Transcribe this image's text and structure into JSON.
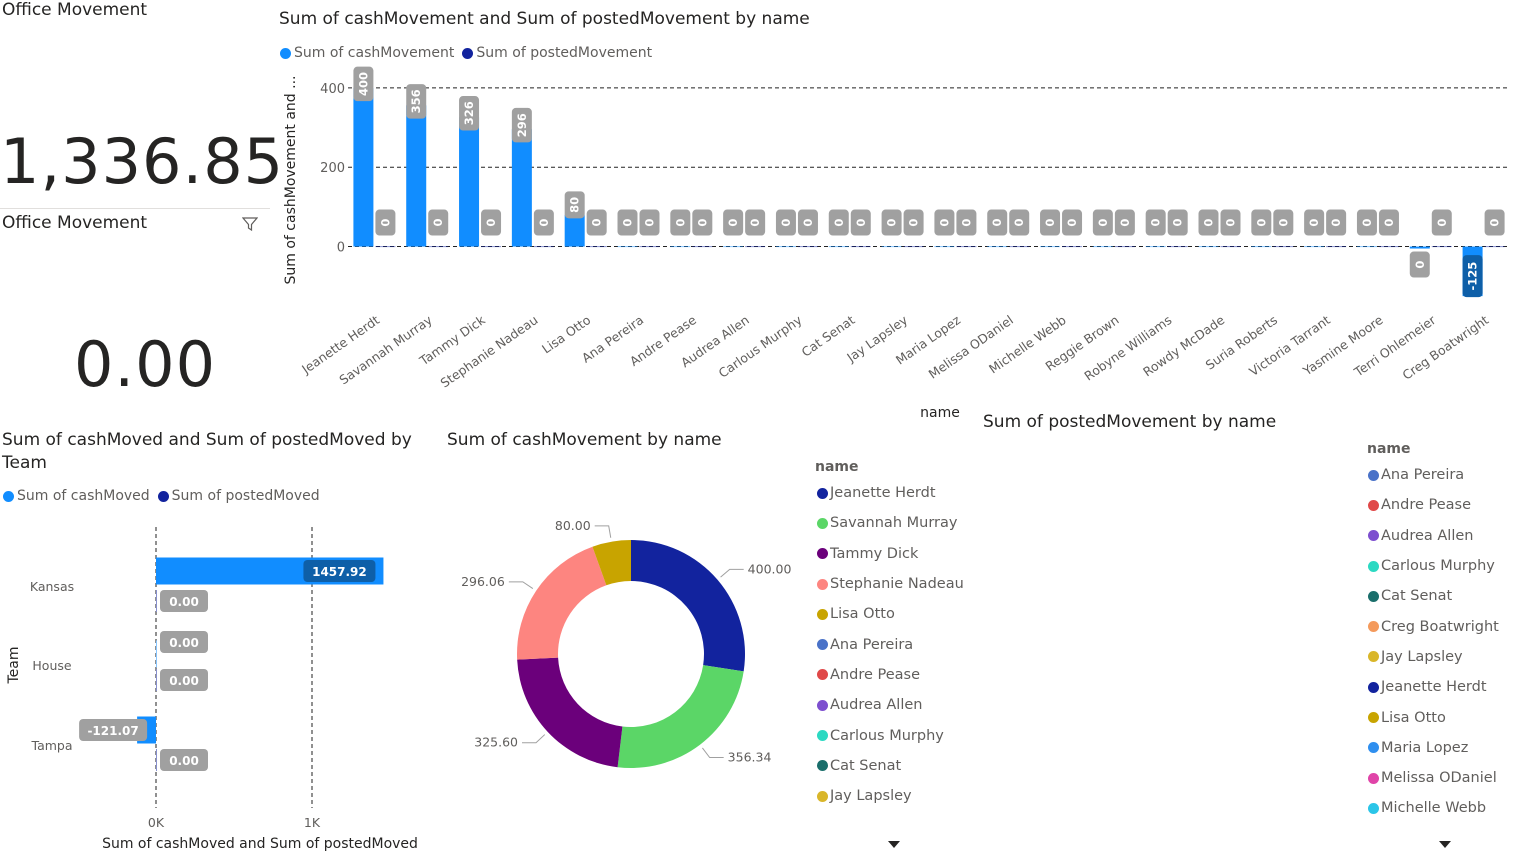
{
  "kpi1": {
    "title": "Office Movement",
    "value": "1,336.85"
  },
  "kpi2": {
    "title": "Office Movement",
    "value": "0.00"
  },
  "colors": {
    "cash": "#118dff",
    "posted": "#12239e",
    "label_bg": "#a0a0a0",
    "label_dark": "#0e5fa8"
  },
  "chart_data": [
    {
      "type": "bar",
      "title": "Sum of cashMovement and Sum of postedMovement by name",
      "xlabel": "name",
      "ylabel": "Sum of cashMovement and ...",
      "ylim": [
        -160,
        420
      ],
      "yticks": [
        0,
        200,
        400
      ],
      "legend": "top-left",
      "grid": true,
      "categories": [
        "Jeanette Herdt",
        "Savannah Murray",
        "Tammy Dick",
        "Stephanie Nadeau",
        "Lisa Otto",
        "Ana Pereira",
        "Andre Pease",
        "Audrea Allen",
        "Carlous Murphy",
        "Cat Senat",
        "Jay Lapsley",
        "Maria Lopez",
        "Melissa ODaniel",
        "Michelle Webb",
        "Reggie Brown",
        "Robyne Williams",
        "Rowdy McDade",
        "Suria Roberts",
        "Victoria Tarrant",
        "Yasmine Moore",
        "Terri Ohlemeier",
        "Creg Boatwright"
      ],
      "series": [
        {
          "name": "Sum of cashMovement",
          "values": [
            400,
            356,
            326,
            296,
            80,
            0,
            0,
            0,
            0,
            0,
            0,
            0,
            0,
            0,
            0,
            0,
            0,
            0,
            0,
            0,
            -5,
            -125
          ],
          "labels": [
            "400",
            "356",
            "326",
            "296",
            "80",
            "0",
            "0",
            "0",
            "0",
            "0",
            "0",
            "0",
            "0",
            "0",
            "0",
            "0",
            "0",
            "0",
            "0",
            "0",
            "0",
            "-125"
          ]
        },
        {
          "name": "Sum of postedMovement",
          "values": [
            0,
            0,
            0,
            0,
            0,
            0,
            0,
            0,
            0,
            0,
            0,
            0,
            0,
            0,
            0,
            0,
            0,
            0,
            0,
            0,
            0,
            0
          ],
          "labels": [
            "0",
            "0",
            "0",
            "0",
            "0",
            "0",
            "0",
            "0",
            "0",
            "0",
            "0",
            "0",
            "0",
            "0",
            "0",
            "0",
            "0",
            "0",
            "0",
            "0",
            "0",
            "0"
          ]
        }
      ]
    },
    {
      "type": "bar",
      "orientation": "horizontal",
      "title": "Sum of cashMoved and Sum of postedMoved by Team",
      "xlabel": "Sum of cashMoved and Sum of postedMoved",
      "ylabel": "Team",
      "xlim": [
        -150,
        1500
      ],
      "xticks": [
        {
          "value": 0,
          "label": "0K"
        },
        {
          "value": 1000,
          "label": "1K"
        }
      ],
      "legend": "top-left",
      "categories": [
        "Kansas",
        "House",
        "Tampa"
      ],
      "series": [
        {
          "name": "Sum of cashMoved",
          "values": [
            1457.92,
            0,
            -121.07
          ],
          "labels": [
            "1457.92",
            "0.00",
            "-121.07"
          ]
        },
        {
          "name": "Sum of postedMoved",
          "values": [
            0,
            0,
            0
          ],
          "labels": [
            "0.00",
            "0.00",
            "0.00"
          ]
        }
      ]
    },
    {
      "type": "pie",
      "donut": true,
      "title": "Sum of cashMovement by name",
      "legend_title": "name",
      "legend": "right",
      "slices": [
        {
          "name": "Jeanette Herdt",
          "value": 400.0,
          "label": "400.00",
          "color": "#12239e"
        },
        {
          "name": "Savannah Murray",
          "value": 356.34,
          "label": "356.34",
          "color": "#5bd667"
        },
        {
          "name": "Tammy Dick",
          "value": 325.6,
          "label": "325.60",
          "color": "#6b007b"
        },
        {
          "name": "Stephanie Nadeau",
          "value": 296.06,
          "label": "296.06",
          "color": "#fd8580"
        },
        {
          "name": "Lisa Otto",
          "value": 80.0,
          "label": "80.00",
          "color": "#c8a400"
        }
      ],
      "legend_items": [
        {
          "name": "Jeanette Herdt",
          "color": "#12239e"
        },
        {
          "name": "Savannah Murray",
          "color": "#5bd667"
        },
        {
          "name": "Tammy Dick",
          "color": "#6b007b"
        },
        {
          "name": "Stephanie Nadeau",
          "color": "#fd8580"
        },
        {
          "name": "Lisa Otto",
          "color": "#c8a400"
        },
        {
          "name": "Ana Pereira",
          "color": "#4a72c8"
        },
        {
          "name": "Andre Pease",
          "color": "#e04848"
        },
        {
          "name": "Audrea Allen",
          "color": "#7d4fcf"
        },
        {
          "name": "Carlous Murphy",
          "color": "#2cd9c2"
        },
        {
          "name": "Cat Senat",
          "color": "#1a6e6b"
        },
        {
          "name": "Jay Lapsley",
          "color": "#d9b62a"
        }
      ]
    },
    {
      "type": "pie",
      "title": "Sum of postedMovement by name",
      "legend_title": "name",
      "legend": "right",
      "slices": [],
      "legend_items": [
        {
          "name": "Ana Pereira",
          "color": "#4a72c8"
        },
        {
          "name": "Andre Pease",
          "color": "#e04848"
        },
        {
          "name": "Audrea Allen",
          "color": "#7d4fcf"
        },
        {
          "name": "Carlous Murphy",
          "color": "#2cd9c2"
        },
        {
          "name": "Cat Senat",
          "color": "#1a6e6b"
        },
        {
          "name": "Creg Boatwright",
          "color": "#f49a5c"
        },
        {
          "name": "Jay Lapsley",
          "color": "#d9b62a"
        },
        {
          "name": "Jeanette Herdt",
          "color": "#12239e"
        },
        {
          "name": "Lisa Otto",
          "color": "#c8a400"
        },
        {
          "name": "Maria Lopez",
          "color": "#2f8fef"
        },
        {
          "name": "Melissa ODaniel",
          "color": "#e044a8"
        },
        {
          "name": "Michelle Webb",
          "color": "#2bc5e8"
        }
      ]
    }
  ]
}
